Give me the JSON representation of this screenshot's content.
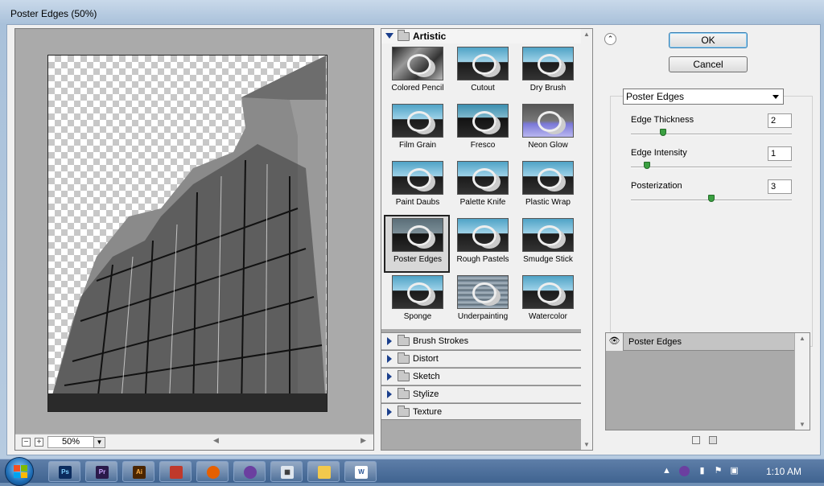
{
  "window": {
    "title": "Poster Edges (50%)"
  },
  "preview": {
    "zoom": "50%",
    "zoom_out": "−",
    "zoom_in": "+"
  },
  "gallery": {
    "open_category": "Artistic",
    "filters": [
      {
        "label": "Colored Pencil"
      },
      {
        "label": "Cutout"
      },
      {
        "label": "Dry Brush"
      },
      {
        "label": "Film Grain"
      },
      {
        "label": "Fresco"
      },
      {
        "label": "Neon Glow"
      },
      {
        "label": "Paint Daubs"
      },
      {
        "label": "Palette Knife"
      },
      {
        "label": "Plastic Wrap"
      },
      {
        "label": "Poster Edges"
      },
      {
        "label": "Rough Pastels"
      },
      {
        "label": "Smudge Stick"
      },
      {
        "label": "Sponge"
      },
      {
        "label": "Underpainting"
      },
      {
        "label": "Watercolor"
      }
    ],
    "selected_filter": "Poster Edges",
    "categories": [
      "Brush Strokes",
      "Distort",
      "Sketch",
      "Stylize",
      "Texture"
    ]
  },
  "buttons": {
    "ok": "OK",
    "cancel": "Cancel"
  },
  "settings": {
    "filter_select": "Poster Edges",
    "params": [
      {
        "label": "Edge Thickness",
        "value": "2",
        "fraction": 0.2
      },
      {
        "label": "Edge Intensity",
        "value": "1",
        "fraction": 0.1
      },
      {
        "label": "Posterization",
        "value": "3",
        "fraction": 0.5
      }
    ]
  },
  "layers": {
    "items": [
      {
        "label": "Poster Edges"
      }
    ]
  },
  "taskbar": {
    "apps": [
      "Ps",
      "Pr",
      "Ai",
      "Flash",
      "Firefox",
      "Eclipse",
      "Calculator",
      "Explorer",
      "W"
    ],
    "clock": "1:10 AM"
  },
  "colors": {
    "accent": "#1b3f8c",
    "taskbar": "#3f6390",
    "ps_blue": "#0b2c5e"
  }
}
